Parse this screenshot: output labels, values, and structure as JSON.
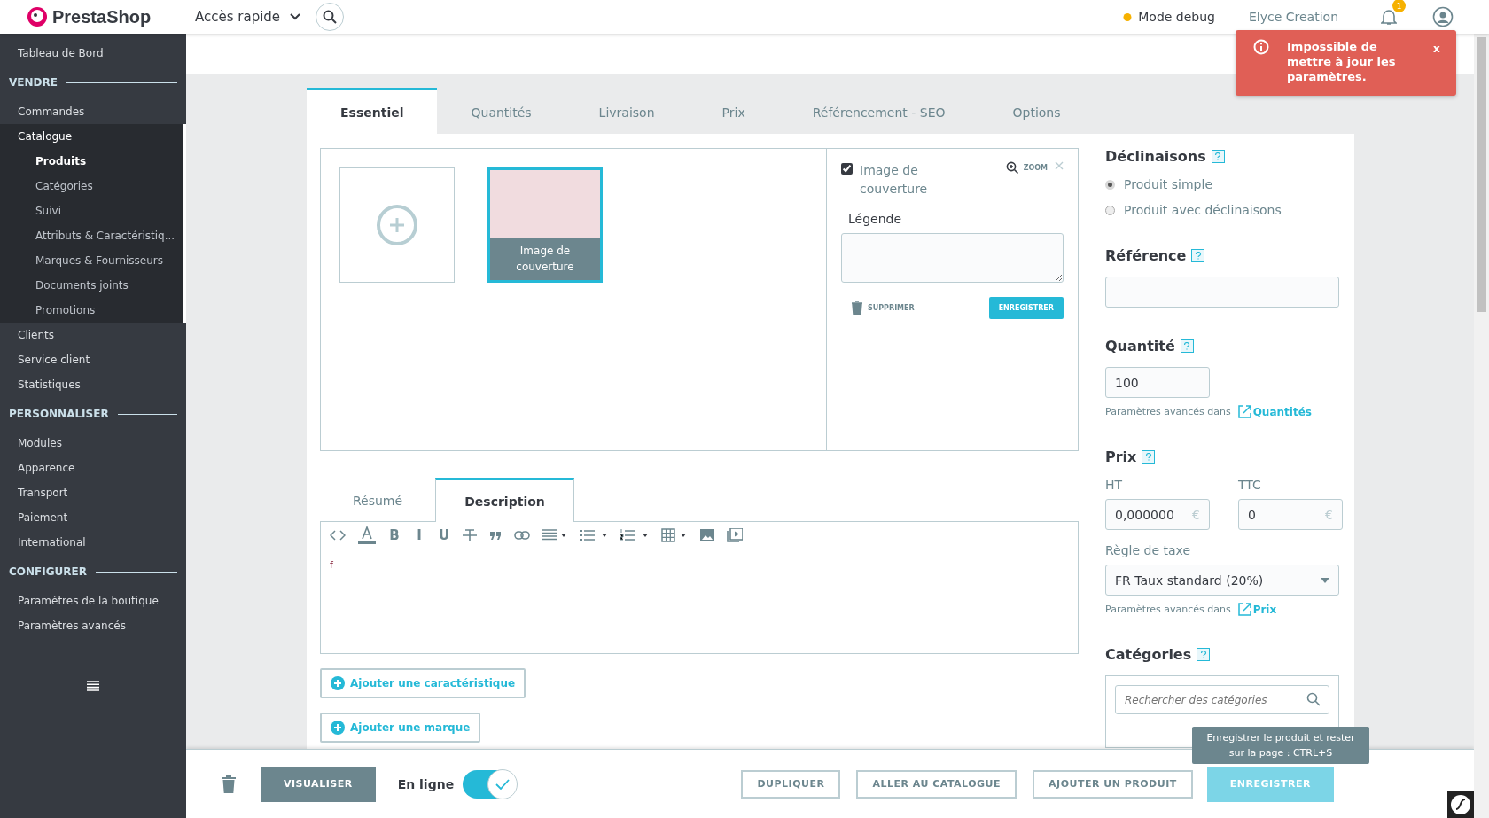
{
  "topbar": {
    "logo": "PrestaShop",
    "quick_access": "Accès rapide",
    "debug": "Mode debug",
    "user": "Elyce Creation",
    "notification_count": "1"
  },
  "toast": {
    "message": "Impossible de mettre à jour les paramètres.",
    "close": "x"
  },
  "sidebar": {
    "items": [
      {
        "kind": "link",
        "label": "Tableau de Bord",
        "selected": false
      },
      {
        "kind": "section",
        "label": "VENDRE"
      },
      {
        "kind": "link",
        "label": "Commandes",
        "selected": false
      },
      {
        "kind": "link",
        "label": "Catalogue",
        "selected": true,
        "children": [
          {
            "label": "Produits",
            "selected": true
          },
          {
            "label": "Catégories",
            "selected": false
          },
          {
            "label": "Suivi",
            "selected": false
          },
          {
            "label": "Attributs & Caractéristiq...",
            "selected": false
          },
          {
            "label": "Marques & Fournisseurs",
            "selected": false
          },
          {
            "label": "Documents joints",
            "selected": false
          },
          {
            "label": "Promotions",
            "selected": false
          }
        ]
      },
      {
        "kind": "link",
        "label": "Clients",
        "selected": false
      },
      {
        "kind": "link",
        "label": "Service client",
        "selected": false
      },
      {
        "kind": "link",
        "label": "Statistiques",
        "selected": false
      },
      {
        "kind": "section",
        "label": "PERSONNALISER"
      },
      {
        "kind": "link",
        "label": "Modules",
        "selected": false
      },
      {
        "kind": "link",
        "label": "Apparence",
        "selected": false
      },
      {
        "kind": "link",
        "label": "Transport",
        "selected": false
      },
      {
        "kind": "link",
        "label": "Paiement",
        "selected": false
      },
      {
        "kind": "link",
        "label": "International",
        "selected": false
      },
      {
        "kind": "section",
        "label": "CONFIGURER"
      },
      {
        "kind": "link",
        "label": "Paramètres de la boutique",
        "selected": false
      },
      {
        "kind": "link",
        "label": "Paramètres avancés",
        "selected": false
      }
    ]
  },
  "tabs": [
    {
      "label": "Essentiel",
      "selected": true
    },
    {
      "label": "Quantités",
      "selected": false
    },
    {
      "label": "Livraison",
      "selected": false
    },
    {
      "label": "Prix",
      "selected": false
    },
    {
      "label": "Référencement - SEO",
      "selected": false
    },
    {
      "label": "Options",
      "selected": false
    }
  ],
  "images": {
    "cover": {
      "caption": "Image de couverture",
      "selected": true
    },
    "panel": {
      "cover_checked": true,
      "cover_label": "Image de couverture",
      "zoom": "ZOOM",
      "caption_label": "Légende",
      "delete": "SUPPRIMER",
      "save": "ENREGISTRER"
    }
  },
  "description": {
    "tabs": [
      {
        "label": "Résumé",
        "selected": false
      },
      {
        "label": "Description",
        "selected": true
      }
    ],
    "toolbar": [
      {
        "kind": "code"
      },
      {
        "kind": "color"
      },
      {
        "kind": "letter",
        "label": "B"
      },
      {
        "kind": "letter",
        "label": "I"
      },
      {
        "kind": "letter",
        "label": "U"
      },
      {
        "kind": "strike"
      },
      {
        "kind": "quote"
      },
      {
        "kind": "link"
      },
      {
        "kind": "align"
      },
      {
        "kind": "bullets"
      },
      {
        "kind": "numbers"
      },
      {
        "kind": "table"
      },
      {
        "kind": "image"
      },
      {
        "kind": "video"
      }
    ],
    "content": "f"
  },
  "add_buttons": [
    "Ajouter une caractéristique",
    "Ajouter une marque"
  ],
  "right": {
    "declinaisons": {
      "title": "Déclinaisons",
      "options": [
        {
          "label": "Produit simple",
          "selected": true
        },
        {
          "label": "Produit avec déclinaisons",
          "selected": false
        }
      ]
    },
    "reference": {
      "title": "Référence"
    },
    "quantity": {
      "title": "Quantité",
      "value": "100",
      "advanced": "Paramètres avancés dans",
      "link": "Quantités"
    },
    "price": {
      "title": "Prix",
      "ht_label": "HT",
      "ht_value": "0,000000",
      "ttc_label": "TTC",
      "ttc_value": "0",
      "currency": "€",
      "tax_label": "Règle de taxe",
      "tax_value": "FR Taux standard (20%)",
      "advanced": "Paramètres avancés dans",
      "link": "Prix"
    },
    "categories": {
      "title": "Catégories",
      "placeholder": "Rechercher des catégories"
    }
  },
  "footer": {
    "preview": "VISUALISER",
    "online_label": "En ligne",
    "online": true,
    "buttons": [
      "DUPLIQUER",
      "ALLER AU CATALOGUE",
      "AJOUTER UN PRODUIT"
    ],
    "save": "ENREGISTRER",
    "tooltip": "Enregistrer le produit et rester sur la page : CTRL+S"
  }
}
